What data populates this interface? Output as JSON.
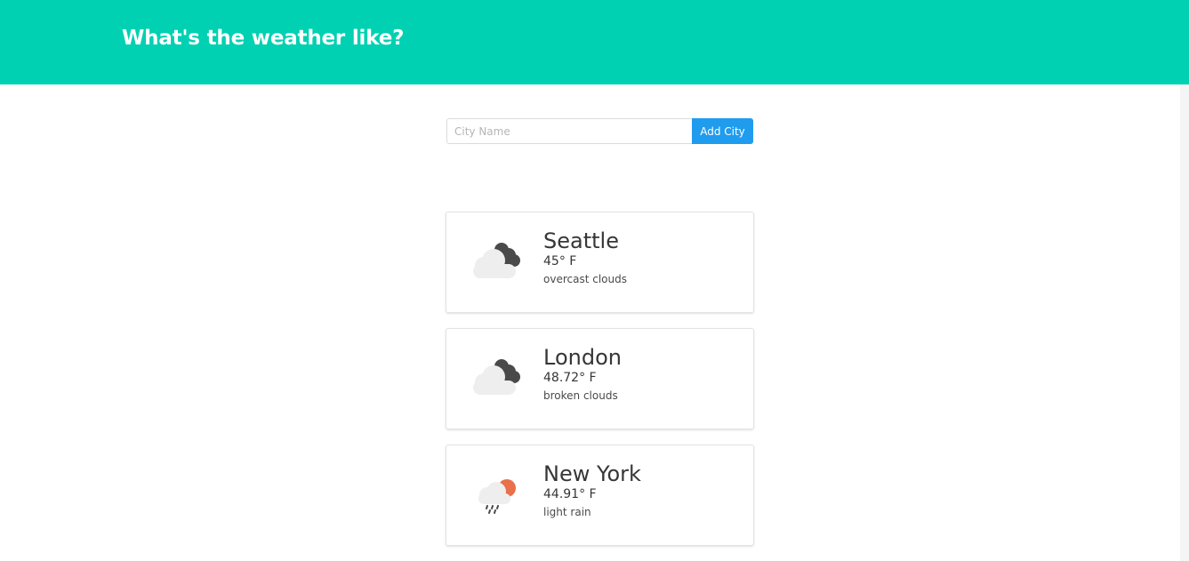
{
  "header": {
    "title": "What's the weather like?"
  },
  "form": {
    "input_value": "",
    "input_placeholder": "City Name",
    "add_button_label": "Add City"
  },
  "colors": {
    "header_bg": "#00d1b2",
    "button_bg": "#209cee"
  },
  "cities": [
    {
      "name": "Seattle",
      "temp": "45° F",
      "description": "overcast clouds",
      "icon": "overcast-clouds-icon"
    },
    {
      "name": "London",
      "temp": "48.72° F",
      "description": "broken clouds",
      "icon": "broken-clouds-icon"
    },
    {
      "name": "New York",
      "temp": "44.91° F",
      "description": "light rain",
      "icon": "light-rain-icon"
    }
  ]
}
